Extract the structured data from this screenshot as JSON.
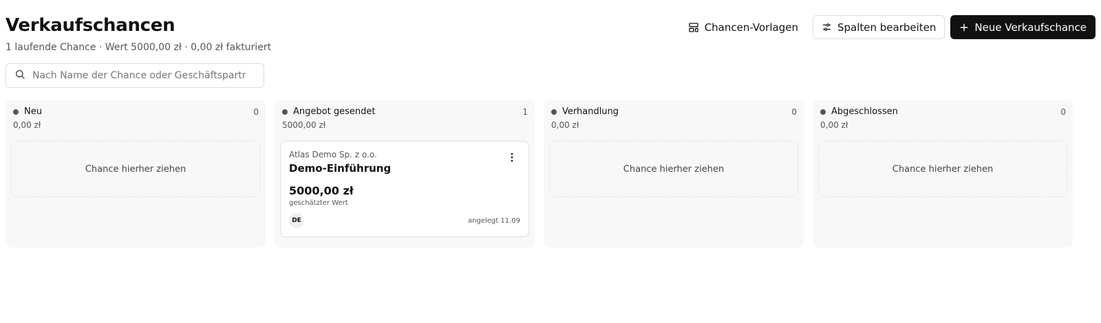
{
  "page": {
    "title": "Verkaufschancen",
    "subtitle": "1 laufende Chance · Wert 5000,00 zł · 0,00 zł fakturiert"
  },
  "toolbar": {
    "templates_label": "Chancen-Vorlagen",
    "edit_columns_label": "Spalten bearbeiten",
    "new_opportunity_label": "Neue Verkaufschance"
  },
  "search": {
    "placeholder": "Nach Name der Chance oder Geschäftspartner suchen",
    "value": ""
  },
  "columns": [
    {
      "name": "Neu",
      "count": "0",
      "sum": "0,00 zł",
      "empty_text": "Chance hierher ziehen"
    },
    {
      "name": "Angebot gesendet",
      "count": "1",
      "sum": "5000,00 zł"
    },
    {
      "name": "Verhandlung",
      "count": "0",
      "sum": "0,00 zł",
      "empty_text": "Chance hierher ziehen"
    },
    {
      "name": "Abgeschlossen",
      "count": "0",
      "sum": "0,00 zł",
      "empty_text": "Chance hierher ziehen"
    }
  ],
  "card": {
    "partner": "Atlas Demo Sp. z o.o.",
    "title": "Demo-Einführung",
    "value": "5000,00 zł",
    "value_label": "geschätzter Wert",
    "avatar": "DE",
    "created": "angelegt 11.09"
  },
  "colors": {
    "primary": "#111111",
    "column_bg": "#f8f8f8",
    "muted_text": "#555555",
    "status_dot": "#555555"
  },
  "icons": {
    "templates": "layout-template-icon",
    "edit_columns": "sliders-icon",
    "new": "plus-icon",
    "search": "search-icon",
    "card_menu": "more-vertical-icon"
  }
}
